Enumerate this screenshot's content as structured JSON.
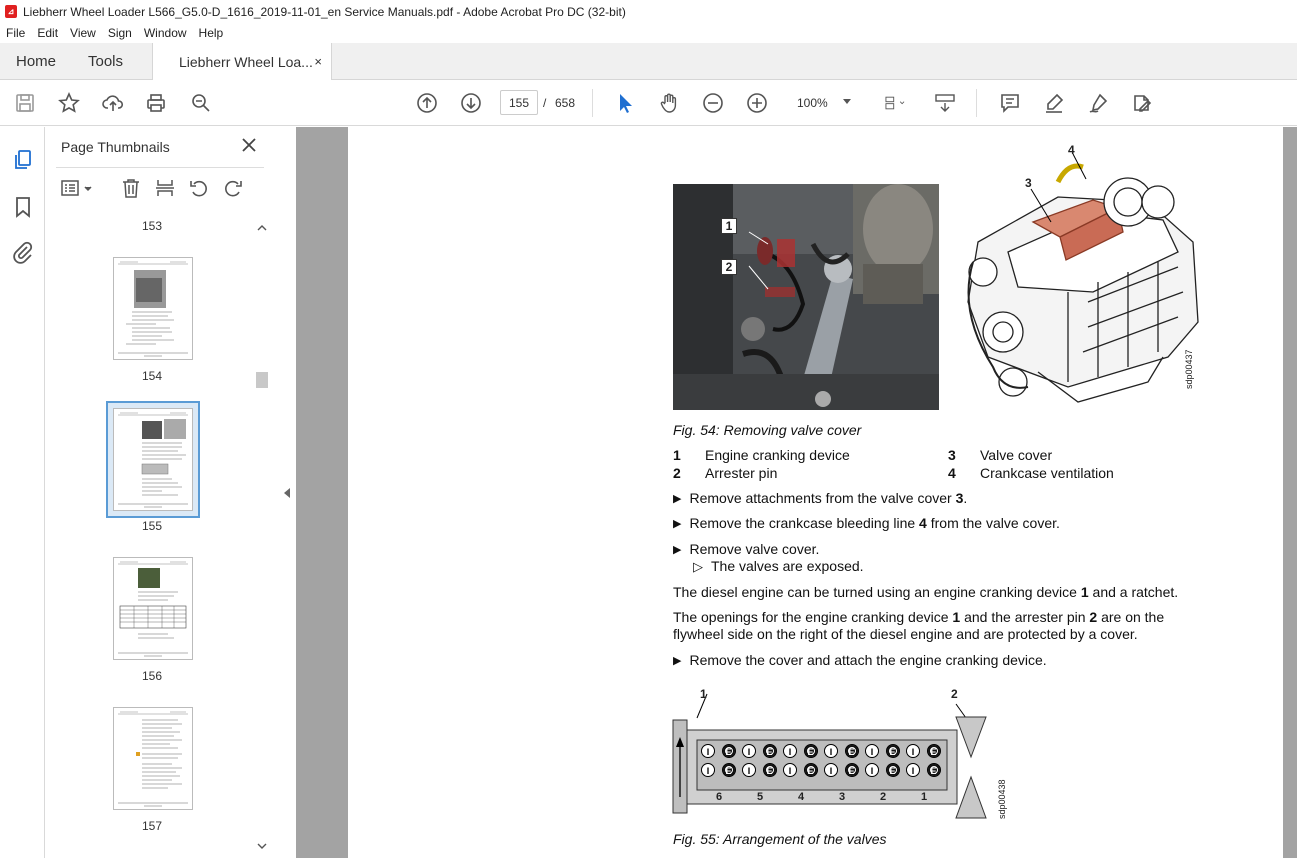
{
  "window": {
    "title": "Liebherr Wheel Loader L566_G5.0-D_1616_2019-11-01_en Service Manuals.pdf - Adobe Acrobat Pro DC (32-bit)"
  },
  "menu": [
    "File",
    "Edit",
    "View",
    "Sign",
    "Window",
    "Help"
  ],
  "tabs": {
    "home": "Home",
    "tools": "Tools",
    "document": "Liebherr Wheel Loa...",
    "close": "×"
  },
  "toolbar": {
    "current_page": "155",
    "separator": "/",
    "total_pages": "658",
    "zoom": "100%"
  },
  "thumbnails": {
    "title": "Page Thumbnails",
    "pages": [
      "153",
      "154",
      "155",
      "156",
      "157"
    ],
    "selected": "155"
  },
  "document": {
    "fig54_caption": "Fig. 54: Removing valve cover",
    "photo_labels": [
      "1",
      "2"
    ],
    "engine_labels": [
      "3",
      "4"
    ],
    "engine_code": "sdp00437",
    "legend": [
      {
        "num": "1",
        "text": "Engine cranking device"
      },
      {
        "num": "2",
        "text": "Arrester pin"
      },
      {
        "num": "3",
        "text": "Valve cover"
      },
      {
        "num": "4",
        "text": "Crankcase ventilation"
      }
    ],
    "step1_pre": "Remove attachments from the valve cover ",
    "step1_num": "3",
    "step1_post": ".",
    "step2_pre": "Remove the crankcase bleeding line ",
    "step2_num": "4",
    "step2_post": " from the valve cover.",
    "step3": "Remove valve cover.",
    "result3": "The valves are exposed.",
    "para1_pre": "The diesel engine can be turned using an engine cranking device ",
    "para1_num": "1",
    "para1_post": " and a ratchet.",
    "para2_l1_a": "The openings for the engine cranking device ",
    "para2_l1_n1": "1",
    "para2_l1_b": " and the arrester pin ",
    "para2_l1_n2": "2",
    "para2_l1_c": " are on the",
    "para2_l2": "flywheel side on the right of the diesel engine and are protected by a cover.",
    "step4": "Remove the cover and attach the engine cranking device.",
    "valve_label_1": "1",
    "valve_label_2": "2",
    "valve_code": "sdp00438",
    "cylinders": [
      "6",
      "5",
      "4",
      "3",
      "2",
      "1"
    ],
    "valve_letter_i": "I",
    "valve_letter_e": "E",
    "fig55_caption": "Fig. 55: Arrangement of the valves"
  }
}
